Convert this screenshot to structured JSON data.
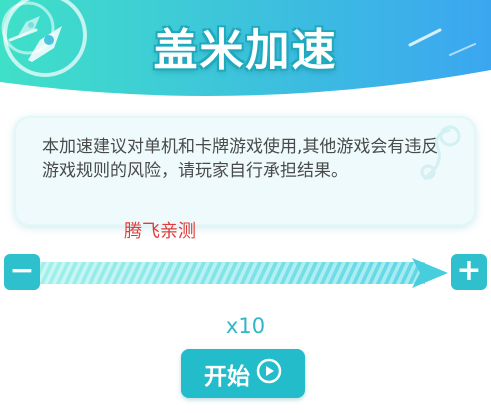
{
  "header": {
    "title": "盖米加速"
  },
  "notice": {
    "text": "本加速建议对单机和卡牌游戏使用,其他游戏会有违反游戏规则的风险，请玩家自行承担结果。"
  },
  "watermark": {
    "text": "腾飞亲测"
  },
  "slider": {
    "minus_label": "−",
    "plus_label": "+",
    "level_fraction": 1.0
  },
  "speed": {
    "multiplier": "x10"
  },
  "start_button": {
    "label": "开始",
    "icon": "play-circle-icon"
  },
  "colors": {
    "accent": "#2fc0cd",
    "header_gradient_start": "#3fe0c8",
    "header_gradient_end": "#3ba6f0",
    "warning_text": "#e23a3a"
  }
}
